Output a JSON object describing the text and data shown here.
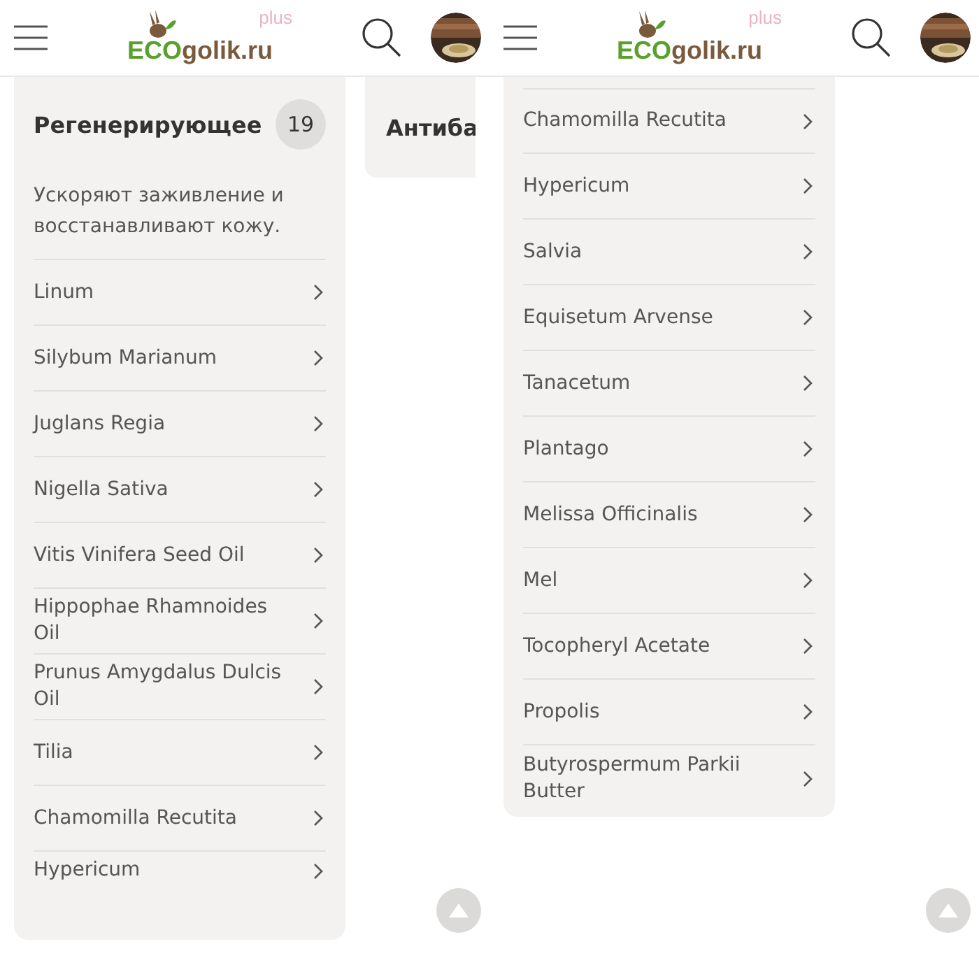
{
  "screens": [
    {
      "logo": {
        "eco": "ECO",
        "name": "golik.ru",
        "plus": "plus"
      },
      "cards": [
        {
          "title": "Регенерирующее",
          "count": "19",
          "description": "Ускоряют заживление и восстанавливают кожу.",
          "items": [
            "Linum",
            "Silybum Marianum",
            "Juglans Regia",
            "Nigella Sativa",
            "Vitis Vinifera Seed Oil",
            "Hippophae Rhamnoides Oil",
            "Prunus Amygdalus Dulcis Oil",
            "Tilia",
            "Chamomilla Recutita",
            "Hypericum"
          ]
        },
        {
          "title": "Антиба"
        }
      ]
    },
    {
      "logo": {
        "eco": "ECO",
        "name": "golik.ru",
        "plus": "plus"
      },
      "cards": [
        {
          "items": [
            "Chamomilla Recutita",
            "Hypericum",
            "Salvia",
            "Equisetum Arvense",
            "Tanacetum",
            "Plantago",
            "Melissa Officinalis",
            "Mel",
            "Tocopheryl Acetate",
            "Propolis",
            "Butyrospermum Parkii Butter"
          ]
        }
      ]
    }
  ]
}
